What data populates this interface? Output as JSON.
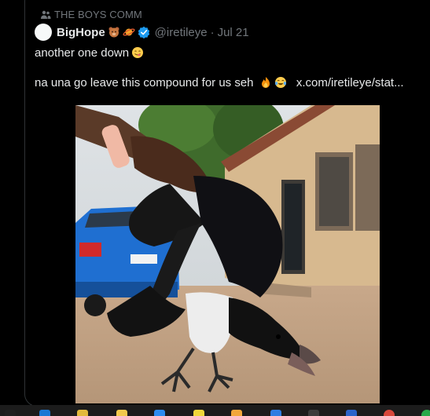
{
  "community": {
    "name": "THE BOYS COMM",
    "icon": "people-icon"
  },
  "post": {
    "display_name": "BigHope",
    "name_emojis": [
      "teddy-bear-emoji",
      "ringed-planet-emoji"
    ],
    "verified_icon": "verified-badge-icon",
    "handle": "@iretileye",
    "separator": "·",
    "date": "Jul 21",
    "text_line1": "another one down",
    "text_line1_emoji": "yum-face-emoji",
    "text_line2": "na una go leave this compound for us seh",
    "text_line2_emojis": [
      "fire-emoji",
      "tears-of-joy-emoji"
    ],
    "link": "x.com/iretileye/stat...",
    "image_label": "hand holding a dead pied crow in a compound with a blue car"
  },
  "colors": {
    "background": "#000000",
    "text_primary": "#e7e9ea",
    "text_secondary": "#71767b",
    "verified": "#1d9bf0",
    "border": "#2f3336"
  },
  "taskbar": {
    "icons": [
      "windows-start-icon",
      "edge-icon",
      "file-explorer-icon",
      "app-icon-4",
      "app-icon-5",
      "app-icon-6",
      "app-icon-7",
      "app-icon-8",
      "app-icon-9",
      "app-icon-10",
      "chrome-icon",
      "app-icon-12"
    ]
  }
}
